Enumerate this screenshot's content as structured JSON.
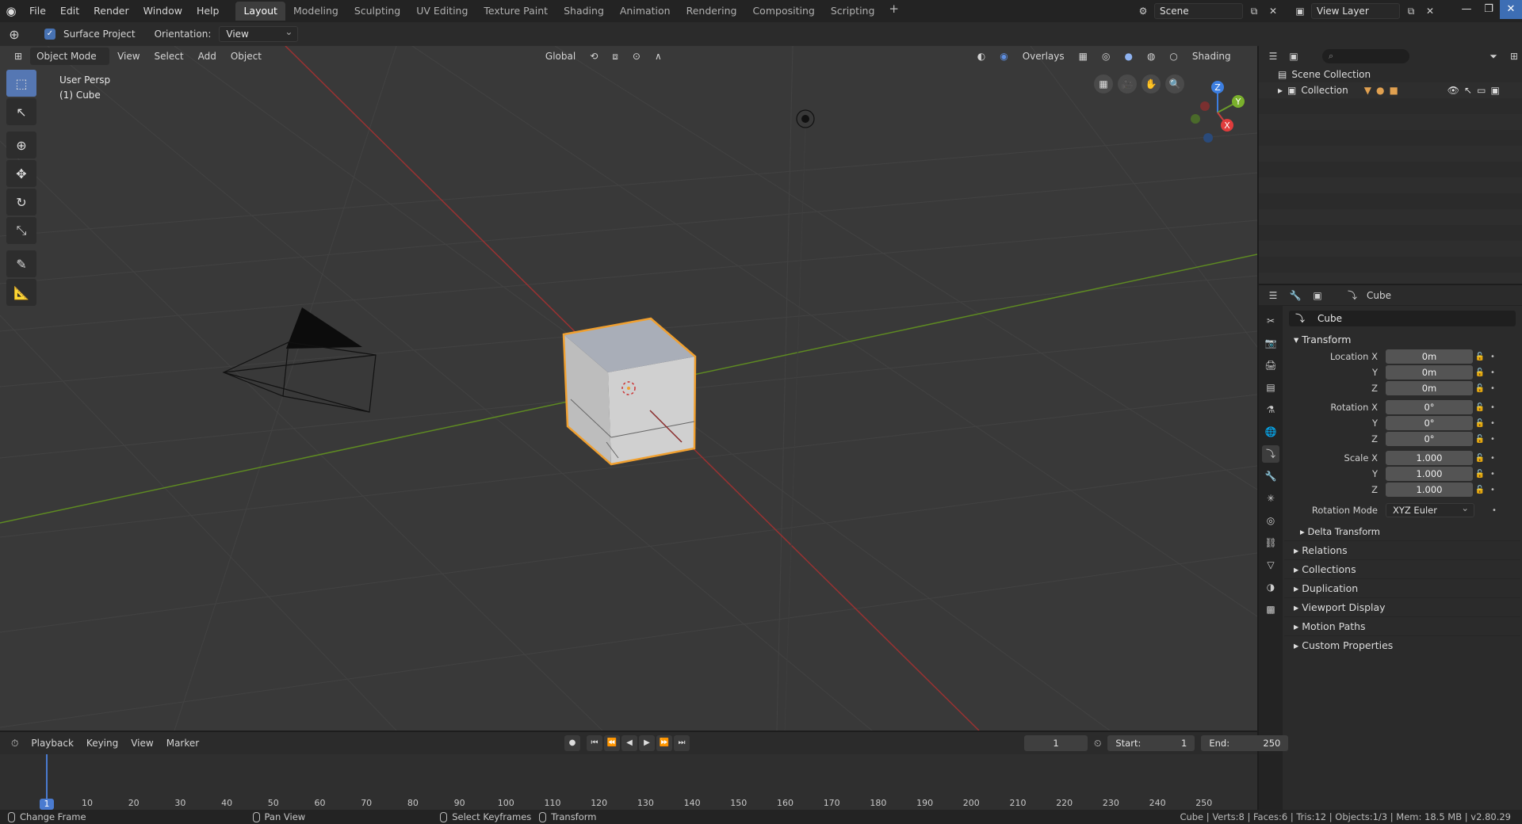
{
  "menu": [
    "File",
    "Edit",
    "Render",
    "Window",
    "Help"
  ],
  "workspaces": [
    "Layout",
    "Modeling",
    "Sculpting",
    "UV Editing",
    "Texture Paint",
    "Shading",
    "Animation",
    "Rendering",
    "Compositing",
    "Scripting"
  ],
  "active_workspace": "Layout",
  "scene": "Scene",
  "view_layer": "View Layer",
  "toolsettings": {
    "surface_project": "Surface Project",
    "orientation_label": "Orientation:",
    "orientation_value": "View"
  },
  "viewport": {
    "mode": "Object Mode",
    "menus": [
      "View",
      "Select",
      "Add",
      "Object"
    ],
    "transform_orientation": "Global",
    "overlays": "Overlays",
    "shading": "Shading",
    "info_line1": "User Persp",
    "info_line2": "(1) Cube",
    "gizmo_axes": [
      "Z",
      "Y",
      "X"
    ]
  },
  "outliner": {
    "scene_collection": "Scene Collection",
    "collection": "Collection"
  },
  "properties": {
    "object_name": "Cube",
    "object_field": "Cube",
    "transform_title": "Transform",
    "location": {
      "label": "Location X",
      "x": "0m",
      "y": "0m",
      "z": "0m"
    },
    "rotation": {
      "label": "Rotation X",
      "x": "0°",
      "y": "0°",
      "z": "0°"
    },
    "scale": {
      "label": "Scale X",
      "x": "1.000",
      "y": "1.000",
      "z": "1.000"
    },
    "axis_y": "Y",
    "axis_z": "Z",
    "rotation_mode_label": "Rotation Mode",
    "rotation_mode_value": "XYZ Euler",
    "delta_transform": "Delta Transform",
    "collapsed_panels": [
      "Relations",
      "Collections",
      "Duplication",
      "Viewport Display",
      "Motion Paths",
      "Custom Properties"
    ]
  },
  "timeline": {
    "menus": [
      "Playback",
      "Keying",
      "View",
      "Marker"
    ],
    "current_frame": "1",
    "start_label": "Start:",
    "start_value": "1",
    "end_label": "End:",
    "end_value": "250",
    "ruler": [
      "10",
      "20",
      "30",
      "40",
      "50",
      "60",
      "70",
      "80",
      "90",
      "100",
      "110",
      "120",
      "130",
      "140",
      "150",
      "160",
      "170",
      "180",
      "190",
      "200",
      "210",
      "220",
      "230",
      "240",
      "250"
    ]
  },
  "status": {
    "change_frame": "Change Frame",
    "pan_view": "Pan View",
    "select_keyframes": "Select Keyframes",
    "transform": "Transform",
    "stats": "Cube | Verts:8 | Faces:6 | Tris:12 | Objects:1/3 | Mem: 18.5 MB | v2.80.29"
  },
  "colors": {
    "accent": "#4772b3",
    "selection_outline": "#f0a030",
    "x_axis": "#b03a3a",
    "y_axis": "#6a9a2a",
    "z_axis": "#3c7ee0"
  }
}
